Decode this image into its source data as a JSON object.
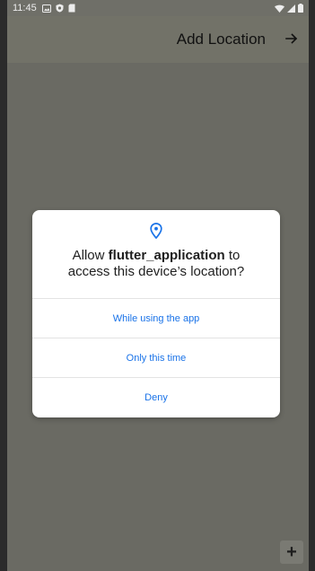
{
  "status_bar": {
    "time": "11:45",
    "icons_left": [
      "image-icon",
      "shield-icon",
      "sd-card-icon"
    ],
    "icons_right": [
      "wifi-icon",
      "signal-icon",
      "battery-icon"
    ]
  },
  "app_bar": {
    "title": "Add Location",
    "action_icon": "arrow-right-icon"
  },
  "dialog": {
    "icon": "location-pin-icon",
    "title_prefix": "Allow ",
    "app_name": "flutter_application",
    "title_suffix_1": " to",
    "title_line_2": "access this device’s location?",
    "options": [
      "While using the app",
      "Only this time",
      "Deny"
    ]
  },
  "fab": {
    "label": "+"
  },
  "colors": {
    "accent": "#1a73e8",
    "scrim": "#6a6a63",
    "dialog_bg": "#ffffff"
  }
}
